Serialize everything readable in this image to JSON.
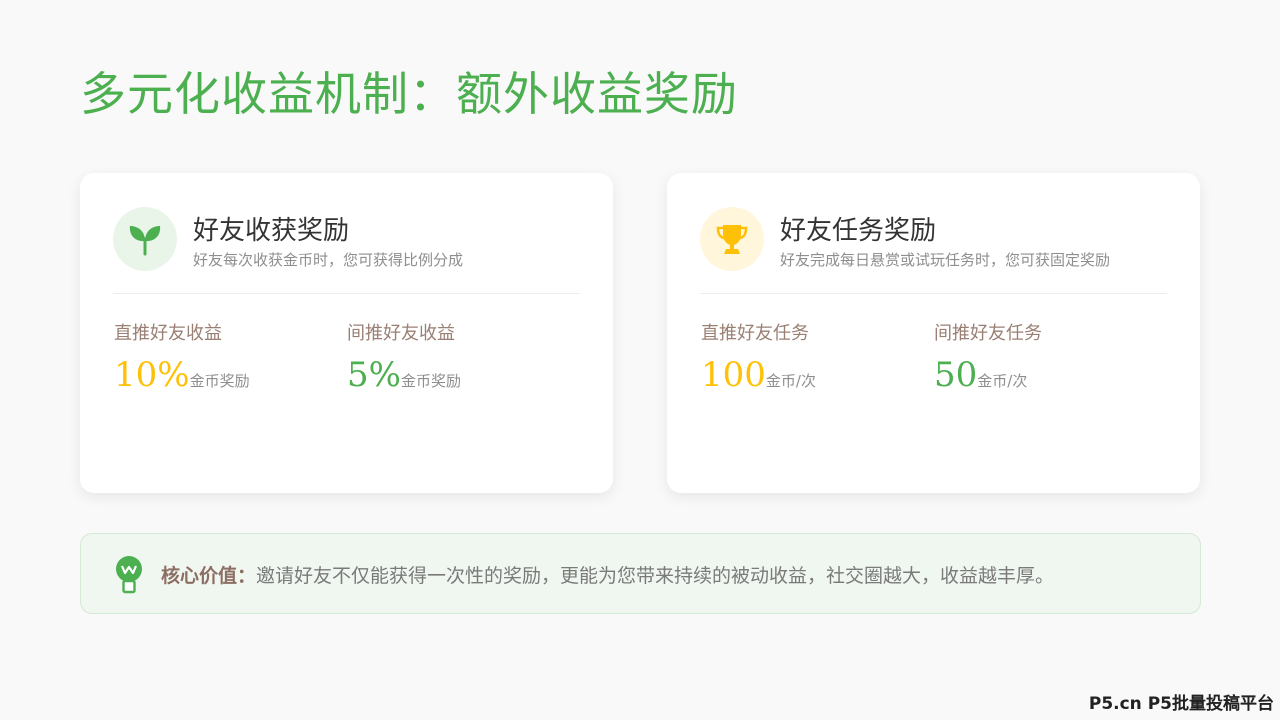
{
  "title": "多元化收益机制：额外收益奖励",
  "colors": {
    "accent_green": "#4caf50",
    "accent_yellow": "#ffc107",
    "label_brown": "#9a7f74"
  },
  "cards": [
    {
      "icon": "sprout-icon",
      "title": "好友收获奖励",
      "description": "好友每次收获金币时，您可获得比例分成",
      "stats": [
        {
          "label": "直推好友收益",
          "value": "10%",
          "unit": "金币奖励"
        },
        {
          "label": "间推好友收益",
          "value": "5%",
          "unit": "金币奖励"
        }
      ]
    },
    {
      "icon": "trophy-icon",
      "title": "好友任务奖励",
      "description": "好友完成每日悬赏或试玩任务时，您可获固定奖励",
      "stats": [
        {
          "label": "直推好友任务",
          "value": "100",
          "unit": "金币/次"
        },
        {
          "label": "间推好友任务",
          "value": "50",
          "unit": "金币/次"
        }
      ]
    }
  ],
  "core": {
    "icon": "lightbulb-icon",
    "label": "核心价值：",
    "text": "邀请好友不仅能获得一次性的奖励，更能为您带来持续的被动收益，社交圈越大，收益越丰厚。"
  },
  "watermark": "P5.cn P5批量投稿平台"
}
